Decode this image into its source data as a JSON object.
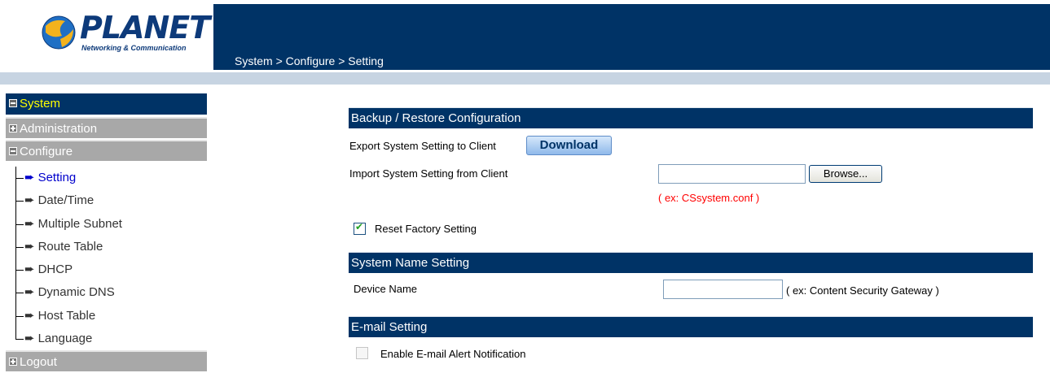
{
  "brand": {
    "name": "PLANET",
    "tagline": "Networking & Communication"
  },
  "breadcrumb": "System > Configure > Setting",
  "sidebar": {
    "system": "System",
    "administration": "Administration",
    "configure": "Configure",
    "sub_items": [
      "Setting",
      "Date/Time",
      "Multiple Subnet",
      "Route Table",
      "DHCP",
      "Dynamic DNS",
      "Host Table",
      "Language"
    ],
    "logout": "Logout"
  },
  "backup": {
    "title": "Backup / Restore Configuration",
    "export_label": "Export System Setting to Client",
    "download_label": "Download",
    "import_label": "Import System Setting from Client",
    "import_value": "",
    "browse_label": "Browse...",
    "import_hint": "( ex: CSsystem.conf )",
    "reset_label": "Reset Factory Setting",
    "reset_checked": true
  },
  "system_name": {
    "title": "System Name Setting",
    "device_label": "Device Name",
    "device_value": "",
    "device_hint": "( ex: Content Security Gateway )"
  },
  "email": {
    "title": "E-mail Setting",
    "enable_label": "Enable E-mail Alert Notification",
    "enable_checked": false
  },
  "colors": {
    "navy": "#003366",
    "system_text": "#ffff00",
    "hint_red": "#ff0000",
    "active_link": "#0000cc"
  }
}
